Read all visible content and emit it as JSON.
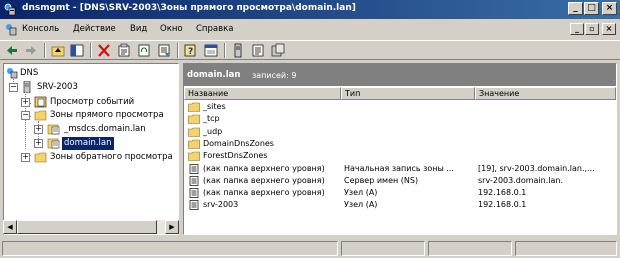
{
  "window": {
    "title": "dnsmgmt - [DNS\\SRV-2003\\Зоны прямого просмотра\\domain.lan]",
    "controls": {
      "minimize": "_",
      "maximize": "□",
      "close": "×"
    }
  },
  "menu": {
    "items": [
      "Консоль",
      "Действие",
      "Вид",
      "Окно",
      "Справка"
    ],
    "mdi_controls": {
      "minimize": "_",
      "restore": "▫",
      "close": "×"
    }
  },
  "toolbar": {
    "buttons": [
      "back-icon",
      "forward-icon",
      "up-folder-icon",
      "show-hide-tree-icon",
      "delete-icon",
      "properties-icon",
      "refresh-icon",
      "export-list-icon",
      "help-icon",
      "mmc-help-icon",
      "server-icon",
      "new-record-icon",
      "new-domain-icon"
    ]
  },
  "tree": {
    "nodes": [
      {
        "label": "DNS",
        "icon": "dns-icon",
        "level": 0,
        "expander": ""
      },
      {
        "label": "SRV-2003",
        "icon": "server-icon",
        "level": 1,
        "expander": "−"
      },
      {
        "label": "Просмотр событий",
        "icon": "event-viewer-icon",
        "level": 2,
        "expander": "+"
      },
      {
        "label": "Зоны прямого просмотра",
        "icon": "folder-icon",
        "level": 2,
        "expander": "−"
      },
      {
        "label": "_msdcs.domain.lan",
        "icon": "zone-icon",
        "level": 3,
        "expander": "+"
      },
      {
        "label": "domain.lan",
        "icon": "zone-icon",
        "level": 3,
        "expander": "+",
        "selected": true
      },
      {
        "label": "Зоны обратного просмотра",
        "icon": "folder-icon",
        "level": 2,
        "expander": "+"
      }
    ]
  },
  "right": {
    "header": {
      "name": "domain.lan",
      "count": "записей: 9"
    },
    "columns": [
      "Название",
      "Тип",
      "Значение"
    ],
    "rows": [
      {
        "icon": "folder-icon",
        "name": "_sites",
        "type": "",
        "value": ""
      },
      {
        "icon": "folder-icon",
        "name": "_tcp",
        "type": "",
        "value": ""
      },
      {
        "icon": "folder-icon",
        "name": "_udp",
        "type": "",
        "value": ""
      },
      {
        "icon": "folder-icon",
        "name": "DomainDnsZones",
        "type": "",
        "value": ""
      },
      {
        "icon": "folder-icon",
        "name": "ForestDnsZones",
        "type": "",
        "value": ""
      },
      {
        "icon": "record-icon",
        "name": "(как папка верхнего уровня)",
        "type": "Начальная запись зоны ...",
        "value": "[19], srv-2003.domain.lan.,..."
      },
      {
        "icon": "record-icon",
        "name": "(как папка верхнего уровня)",
        "type": "Сервер имен (NS)",
        "value": "srv-2003.domain.lan."
      },
      {
        "icon": "record-icon",
        "name": "(как папка верхнего уровня)",
        "type": "Узел (A)",
        "value": "192.168.0.1"
      },
      {
        "icon": "record-icon",
        "name": "srv-2003",
        "type": "Узел (A)",
        "value": "192.168.0.1"
      }
    ]
  },
  "colors": {
    "title_bar": "#0a246a",
    "selection": "#0a246a",
    "face": "#d4d0c8",
    "header_band": "#808080"
  }
}
